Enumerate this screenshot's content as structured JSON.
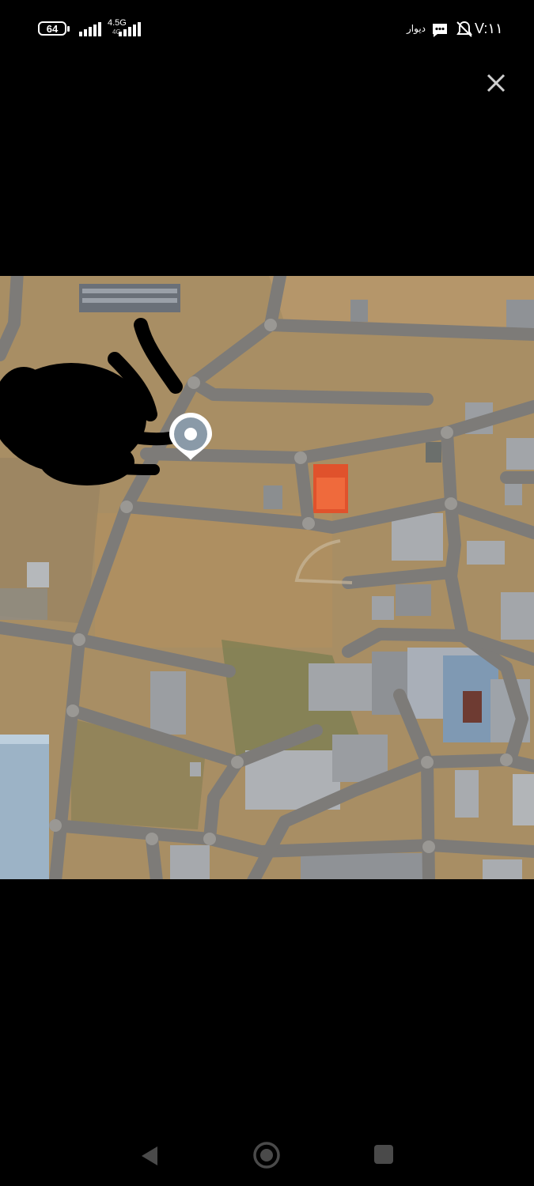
{
  "status_bar": {
    "battery": "64",
    "network": "4.5G",
    "network_sub": "4G",
    "app_name": "دیوار",
    "time": "V:۱۱"
  },
  "viewer": {
    "close_icon": "close-icon"
  },
  "map": {
    "type": "satellite",
    "marker_icon": "location-pin-icon",
    "road_color": "#7d7b78",
    "ground_color": "#a88e64",
    "marker_color": "#8a9aa8",
    "scribble_color": "#000000"
  },
  "navigation_bar": {
    "back_icon": "back-icon",
    "home_icon": "home-icon",
    "recents_icon": "recents-icon"
  }
}
